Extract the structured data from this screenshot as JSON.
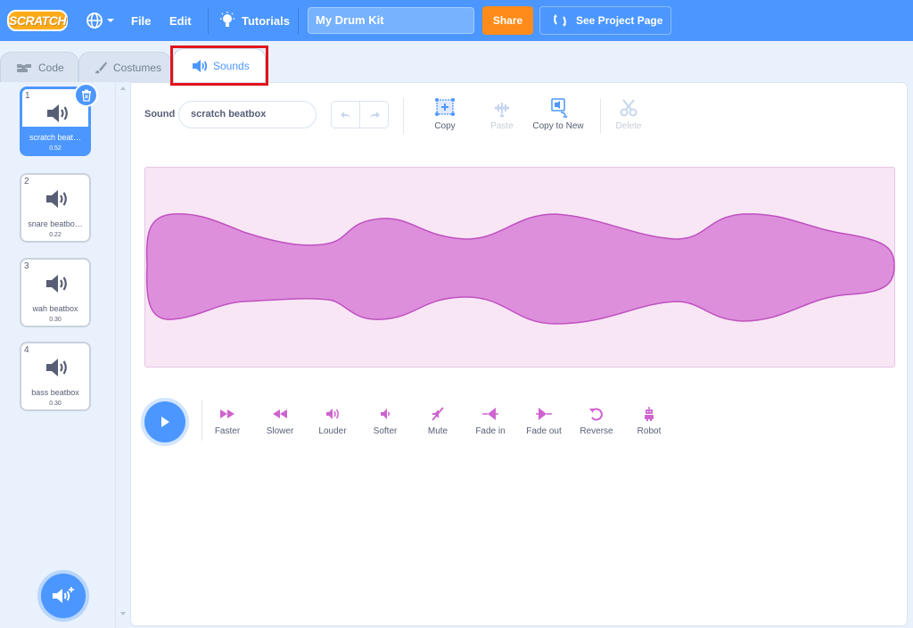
{
  "menubar": {
    "logo": "SCRATCH",
    "file": "File",
    "edit": "Edit",
    "tutorials": "Tutorials",
    "project_title": "My Drum Kit",
    "share": "Share",
    "see_project": "See Project Page"
  },
  "tabs": [
    {
      "label": "Code"
    },
    {
      "label": "Costumes"
    },
    {
      "label": "Sounds"
    }
  ],
  "sounds": [
    {
      "num": "1",
      "name": "scratch beat…",
      "duration": "0.52"
    },
    {
      "num": "2",
      "name": "snare beatbo…",
      "duration": "0.22"
    },
    {
      "num": "3",
      "name": "wah beatbox",
      "duration": "0.30"
    },
    {
      "num": "4",
      "name": "bass beatbox",
      "duration": "0.30"
    }
  ],
  "editor": {
    "sound_label": "Sound",
    "sound_name": "scratch beatbox",
    "tools": {
      "copy": "Copy",
      "paste": "Paste",
      "copy_to_new": "Copy to New",
      "delete": "Delete"
    },
    "effects": {
      "faster": "Faster",
      "slower": "Slower",
      "louder": "Louder",
      "softer": "Softer",
      "mute": "Mute",
      "fade_in": "Fade in",
      "fade_out": "Fade out",
      "reverse": "Reverse",
      "robot": "Robot"
    }
  },
  "colors": {
    "menubar": "#4c97ff",
    "share": "#ff8c1a",
    "waveform_fill": "#dd8fdc",
    "waveform_bg": "#f8e6f5",
    "effect_icon": "#cf63cf",
    "highlight": "#e1141c"
  }
}
